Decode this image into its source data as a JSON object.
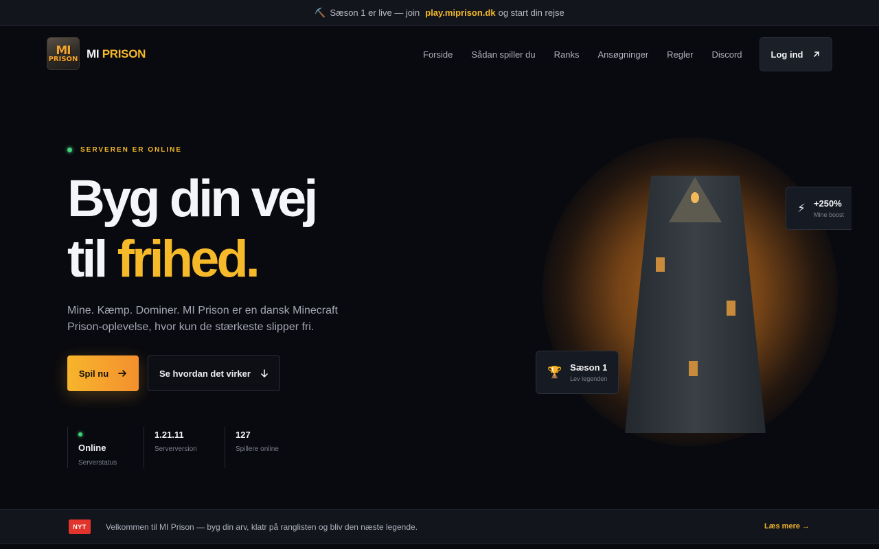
{
  "announcement": {
    "icon": "pickaxe-icon",
    "prefix": "Sæson 1 er live — join",
    "server_address": "play.miprison.dk",
    "suffix": "og start din rejse"
  },
  "nav": {
    "logo_text_line1": "MI",
    "logo_text_line2": "PRISON",
    "brand_first": "MI",
    "brand_second": "PRISON",
    "items": [
      {
        "label": "Forside"
      },
      {
        "label": "Sådan spiller du"
      },
      {
        "label": "Ranks"
      },
      {
        "label": "Ansøgninger"
      },
      {
        "label": "Regler"
      },
      {
        "label": "Discord"
      }
    ],
    "login_label": "Log ind",
    "login_icon": "arrow-up-right-icon"
  },
  "hero": {
    "status_badge": "SERVEREN ER ONLINE",
    "headline_line1": "Byg din vej",
    "headline_line2_plain": "til ",
    "headline_line2_accent": "frihed.",
    "lead": "Mine. Kæmp. Dominer. MI Prison er en dansk Minecraft Prison-oplevelse, hvor kun de stærkeste slipper fri.",
    "primary_button": "Spil nu",
    "secondary_button": "Se hvordan det virker"
  },
  "stats": [
    {
      "value": "Online",
      "label": "Serverstatus"
    },
    {
      "value": "1.21.11",
      "label": "Serverversion"
    },
    {
      "value": "127",
      "label": "Spillere online"
    }
  ],
  "cards": {
    "boost": {
      "icon": "lightning-icon",
      "title": "+250%",
      "subtitle": "Mine boost"
    },
    "season": {
      "icon": "trophy-icon",
      "title": "Sæson 1",
      "subtitle": "Lev legenden"
    }
  },
  "news": {
    "tag": "NYT",
    "message": "Velkommen til MI Prison — byg din arv, klatr på ranglisten og bliv den næste legende.",
    "link": "Læs mere →"
  },
  "colors": {
    "accent": "#f5b92a",
    "online": "#41d27a",
    "background": "#090a0f",
    "news_tag": "#e0342c"
  }
}
